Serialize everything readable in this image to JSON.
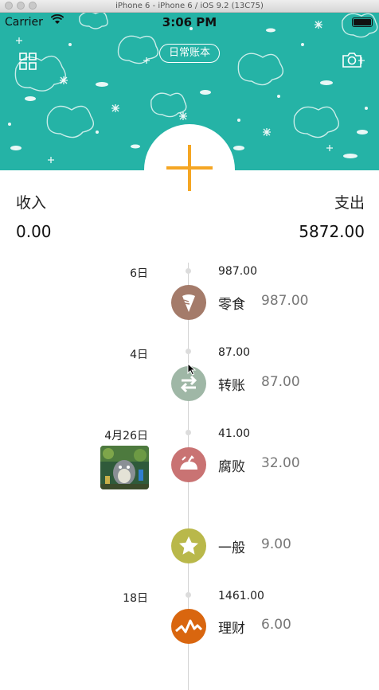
{
  "simulator": {
    "title": "iPhone 6 - iPhone 6 / iOS 9.2 (13C75)"
  },
  "status_bar": {
    "carrier": "Carrier",
    "time": "3:06 PM"
  },
  "header": {
    "book_name": "日常账本",
    "accent_color": "#25b3a6",
    "add_button_color": "#f5a623",
    "icons": [
      "grid-icon",
      "camera-icon",
      "plus-icon"
    ]
  },
  "summary": {
    "income_label": "收入",
    "income_value": "0.00",
    "expense_label": "支出",
    "expense_value": "5872.00"
  },
  "timeline": [
    {
      "date": "6日",
      "total": "987.00",
      "items": [
        {
          "category": "零食",
          "amount": "987.00",
          "icon": "carrot-icon",
          "color": "#a47b6a"
        }
      ]
    },
    {
      "date": "4日",
      "total": "87.00",
      "items": [
        {
          "category": "转账",
          "amount": "87.00",
          "icon": "transfer-icon",
          "color": "#9fb7a6"
        }
      ]
    },
    {
      "date": "4月26日",
      "total": "41.00",
      "has_photo": true,
      "items": [
        {
          "category": "腐败",
          "amount": "32.00",
          "icon": "turkey-icon",
          "color": "#c97373"
        },
        {
          "category": "一般",
          "amount": "9.00",
          "icon": "star-icon",
          "color": "#b9b84a"
        }
      ]
    },
    {
      "date": "18日",
      "total": "1461.00",
      "items": [
        {
          "category": "理财",
          "amount": "6.00",
          "icon": "chart-line-icon",
          "color": "#d9660f"
        }
      ]
    }
  ]
}
